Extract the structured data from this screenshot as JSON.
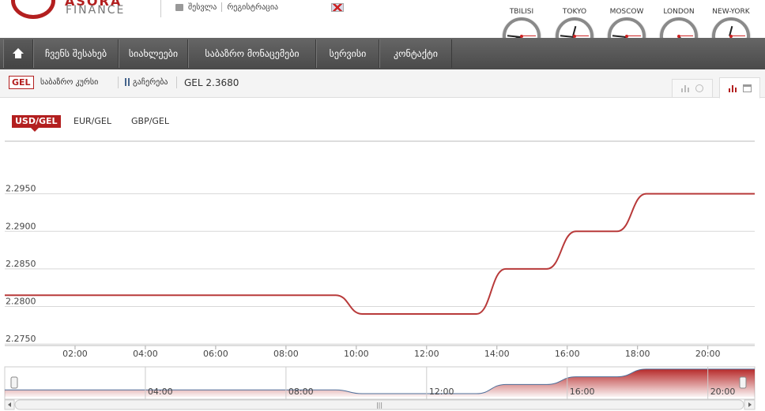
{
  "header": {
    "logo_top": "ASORA",
    "logo_bottom": "FINANCE",
    "login_label": "შესვლა",
    "register_label": "რეგისტრაცია"
  },
  "clocks": [
    {
      "city": "TBILISI",
      "hour": 8.5,
      "minute": 46,
      "second": 15
    },
    {
      "city": "TOKYO",
      "hour": 12.5,
      "minute": 46,
      "second": 15
    },
    {
      "city": "MOSCOW",
      "hour": 7.5,
      "minute": 46,
      "second": 15
    },
    {
      "city": "LONDON",
      "hour": 4.8,
      "minute": 31,
      "second": 15
    },
    {
      "city": "NEW-YORK",
      "hour": 0.5,
      "minute": 31,
      "second": 15
    }
  ],
  "nav": {
    "items": [
      "ჩვენს შესახებ",
      "სიახლეები",
      "საბაზრო მონაცემები",
      "სერვისი",
      "კონტაქტი"
    ]
  },
  "subbar": {
    "currency": "GEL",
    "rate_link": "საბაზრო კურსი",
    "pause_label": "გაჩერება",
    "rate_value": "GEL 2.3680"
  },
  "tabs": [
    "USD/GEL",
    "EUR/GEL",
    "GBP/GEL"
  ],
  "chart_data": {
    "type": "line",
    "series": [
      {
        "values": [
          {
            "x": "00:00",
            "y": 2.2815
          },
          {
            "x": "09:25",
            "y": 2.2815
          },
          {
            "x": "10:10",
            "y": 2.279
          },
          {
            "x": "13:25",
            "y": 2.279
          },
          {
            "x": "14:15",
            "y": 2.285
          },
          {
            "x": "15:25",
            "y": 2.285
          },
          {
            "x": "16:15",
            "y": 2.29
          },
          {
            "x": "17:25",
            "y": 2.29
          },
          {
            "x": "18:15",
            "y": 2.295
          },
          {
            "x": "21:20",
            "y": 2.295
          }
        ]
      }
    ],
    "y_ticks": [
      "2.2750",
      "2.2800",
      "2.2850",
      "2.2900",
      "2.2950"
    ],
    "x_ticks": [
      "02:00",
      "04:00",
      "06:00",
      "08:00",
      "10:00",
      "12:00",
      "14:00",
      "16:00",
      "18:00",
      "20:00"
    ],
    "navigator_ticks": [
      "04:00",
      "08:00",
      "12:00",
      "16:00",
      "20:00"
    ],
    "ylim": [
      2.2748,
      2.302
    ],
    "xlim": [
      "00:00",
      "21:20"
    ],
    "grid": true,
    "line_color": "#b83a3a",
    "navigator_line_color": "#4f6f9a",
    "navigator_fill_color": "#b31f1f"
  },
  "colors": {
    "accent": "#b31f1f",
    "nav_bg": "#555555"
  }
}
